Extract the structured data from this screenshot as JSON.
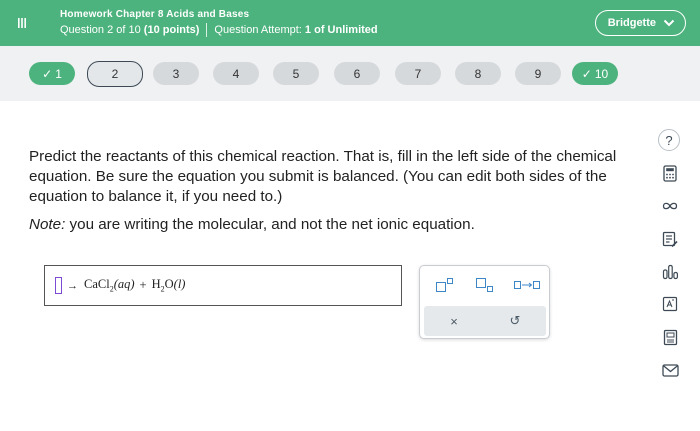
{
  "header": {
    "assignment_title": "Homework Chapter 8 Acids and Bases",
    "question_prefix": "Question 2 of 10",
    "question_points": "(10 points)",
    "attempt_prefix": "Question Attempt:",
    "attempt_value": "1 of Unlimited",
    "user_name": "Bridgette"
  },
  "question_nav": [
    {
      "label": "1",
      "status": "done"
    },
    {
      "label": "2",
      "status": "current"
    },
    {
      "label": "3",
      "status": "unanswered"
    },
    {
      "label": "4",
      "status": "unanswered"
    },
    {
      "label": "5",
      "status": "unanswered"
    },
    {
      "label": "6",
      "status": "unanswered"
    },
    {
      "label": "7",
      "status": "unanswered"
    },
    {
      "label": "8",
      "status": "unanswered"
    },
    {
      "label": "9",
      "status": "unanswered"
    },
    {
      "label": "10",
      "status": "done"
    }
  ],
  "question": {
    "text": "Predict the reactants of this chemical reaction. That is, fill in the left side of the chemical equation. Be sure the equation you submit is balanced. (You can edit both sides of the equation to balance it, if you need to.)",
    "note_label": "Note:",
    "note_text": " you are writing the molecular, and not the net ionic equation."
  },
  "equation": {
    "arrow": "→",
    "p1_main": "CaCl",
    "p1_sub": "2",
    "p1_state": "(aq)",
    "plus": "+",
    "p2_h": "H",
    "p2_sub": "2",
    "p2_o": "O",
    "p2_state": "(l)"
  },
  "palette": {
    "undo_glyph": "↺",
    "clear_glyph": "×"
  },
  "colors": {
    "brand_green": "#4db37e",
    "nav_gray": "#d6d9dc",
    "current_border": "#3d4a55",
    "slot_purple": "#7b4bd6"
  },
  "right_toolbar_icons": [
    "help-icon",
    "calculator-icon",
    "infinity-icon",
    "notes-icon",
    "bar-chart-icon",
    "reference-icon",
    "periodic-table-icon",
    "mail-icon"
  ],
  "help_label": "?"
}
